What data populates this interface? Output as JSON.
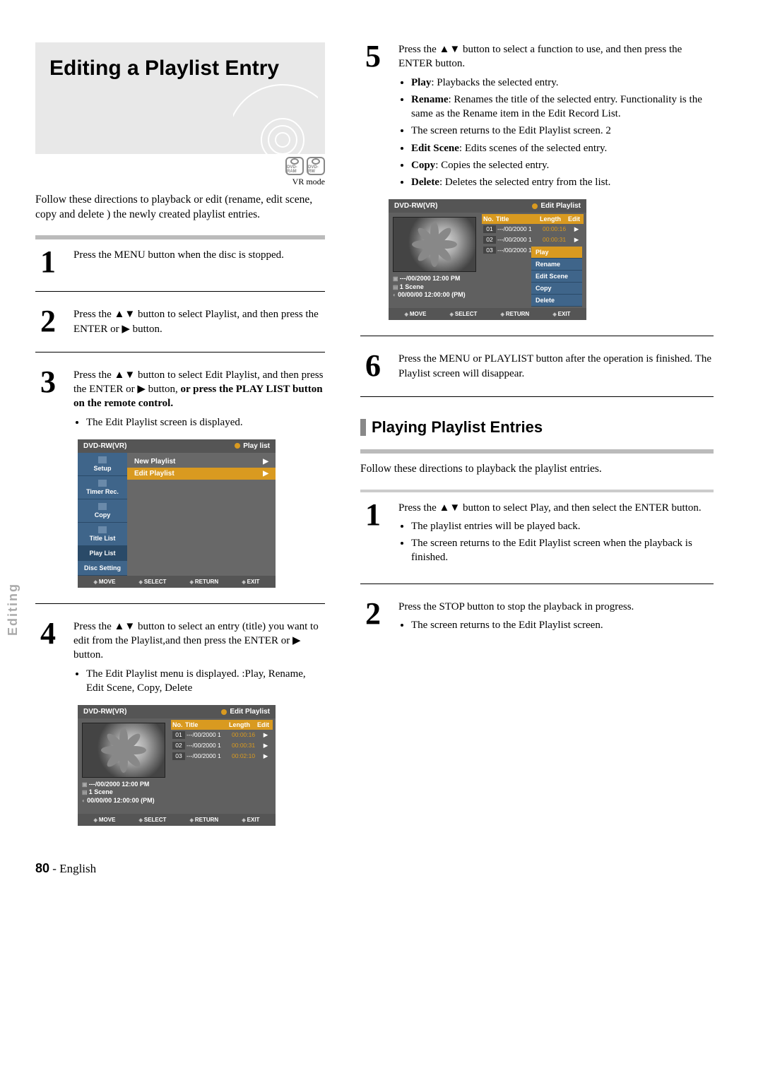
{
  "side_label": "Editing",
  "title": "Editing a Playlist Entry",
  "badges": [
    "DVD-RAM",
    "DVD-RW"
  ],
  "vr_mode": "VR mode",
  "intro": "Follow these directions to playback or edit (rename, edit scene, copy and delete ) the newly created playlist entries.",
  "step1": "Press the MENU button when the disc is stopped.",
  "step2": "Press the ▲▼ button to select Playlist, and then press the ENTER or ▶ button.",
  "step3_line1": "Press the ▲▼ button to select Edit Playlist, and then press the ENTER or ▶ button,",
  "step3_bold": "or press the PLAY LIST button on the remote control.",
  "step3_bullet": "The Edit Playlist screen is displayed.",
  "step4_line1": "Press the ▲▼ button to select an entry (title) you want to edit from the Playlist,and then press the ENTER or ▶ button.",
  "step4_bullet": "The Edit Playlist menu is displayed. :Play, Rename, Edit Scene, Copy, Delete",
  "step5_line1": "Press the ▲▼ button to select a function to use, and then press the ENTER button.",
  "step5_bullets": [
    {
      "b": "Play",
      "t": ": Playbacks the selected entry."
    },
    {
      "b": "Rename",
      "t": ": Renames the title of the selected entry. Functionality is the same as the Rename item in the Edit Record List."
    },
    {
      "b": "",
      "t": "The screen returns to the Edit Playlist screen. 2"
    },
    {
      "b": "Edit Scene",
      "t": ": Edits scenes of the selected entry."
    },
    {
      "b": "Copy",
      "t": ": Copies the selected entry."
    },
    {
      "b": "Delete",
      "t": ": Deletes the selected entry from the list."
    }
  ],
  "step6": "Press the MENU or PLAYLIST button after the operation is finished. The Playlist screen will disappear.",
  "section2_heading": "Playing Playlist Entries",
  "section2_intro": "Follow these directions to playback the playlist entries.",
  "s2_step1_line1": "Press the ▲▼ button to select Play, and then select the ENTER button.",
  "s2_step1_bullets": [
    "The playlist entries will be played back.",
    "The screen returns to the Edit Playlist screen when the playback is finished."
  ],
  "s2_step2_line1": "Press the STOP button to stop the playback in progress.",
  "s2_step2_bullet": "The screen returns to the Edit Playlist screen.",
  "footer_page": "80",
  "footer_lang": " - English",
  "screen1": {
    "header_left": "DVD-RW(VR)",
    "header_right": "Play list",
    "menu_items": [
      "Setup",
      "Timer Rec.",
      "Copy",
      "Title List",
      "Play List",
      "Disc Setting"
    ],
    "options": [
      "New Playlist",
      "Edit Playlist"
    ],
    "footer": [
      "MOVE",
      "SELECT",
      "RETURN",
      "EXIT"
    ]
  },
  "screen2": {
    "header_left": "DVD-RW(VR)",
    "header_right": "Edit Playlist",
    "meta": [
      "---/00/2000 12:00 PM",
      "1 Scene",
      "00/00/00 12:00:00 (PM)"
    ],
    "thead": {
      "no": "No.",
      "title": "Title",
      "length": "Length",
      "edit": "Edit"
    },
    "rows": [
      {
        "no": "01",
        "title": "---/00/2000 1",
        "len": "00:00:16",
        "ed": "▶"
      },
      {
        "no": "02",
        "title": "---/00/2000 1",
        "len": "00:00:31",
        "ed": "▶"
      },
      {
        "no": "03",
        "title": "---/00/2000 1",
        "len": "00:02:10",
        "ed": "▶"
      }
    ],
    "footer": [
      "MOVE",
      "SELECT",
      "RETURN",
      "EXIT"
    ]
  },
  "screen3": {
    "header_left": "DVD-RW(VR)",
    "header_right": "Edit Playlist",
    "meta": [
      "---/00/2000 12:00 PM",
      "1 Scene",
      "00/00/00 12:00:00 (PM)"
    ],
    "thead": {
      "no": "No.",
      "title": "Title",
      "length": "Length",
      "edit": "Edit"
    },
    "rows": [
      {
        "no": "01",
        "title": "---/00/2000 1",
        "len": "00:00:16",
        "ed": "▶"
      },
      {
        "no": "02",
        "title": "---/00/2000 1",
        "len": "00:00:31",
        "ed": "▶"
      },
      {
        "no": "03",
        "title": "---/00/2000 1",
        "len": "",
        "ed": ""
      }
    ],
    "ctx": [
      "Play",
      "Rename",
      "Edit Scene",
      "Copy",
      "Delete"
    ],
    "footer": [
      "MOVE",
      "SELECT",
      "RETURN",
      "EXIT"
    ]
  }
}
